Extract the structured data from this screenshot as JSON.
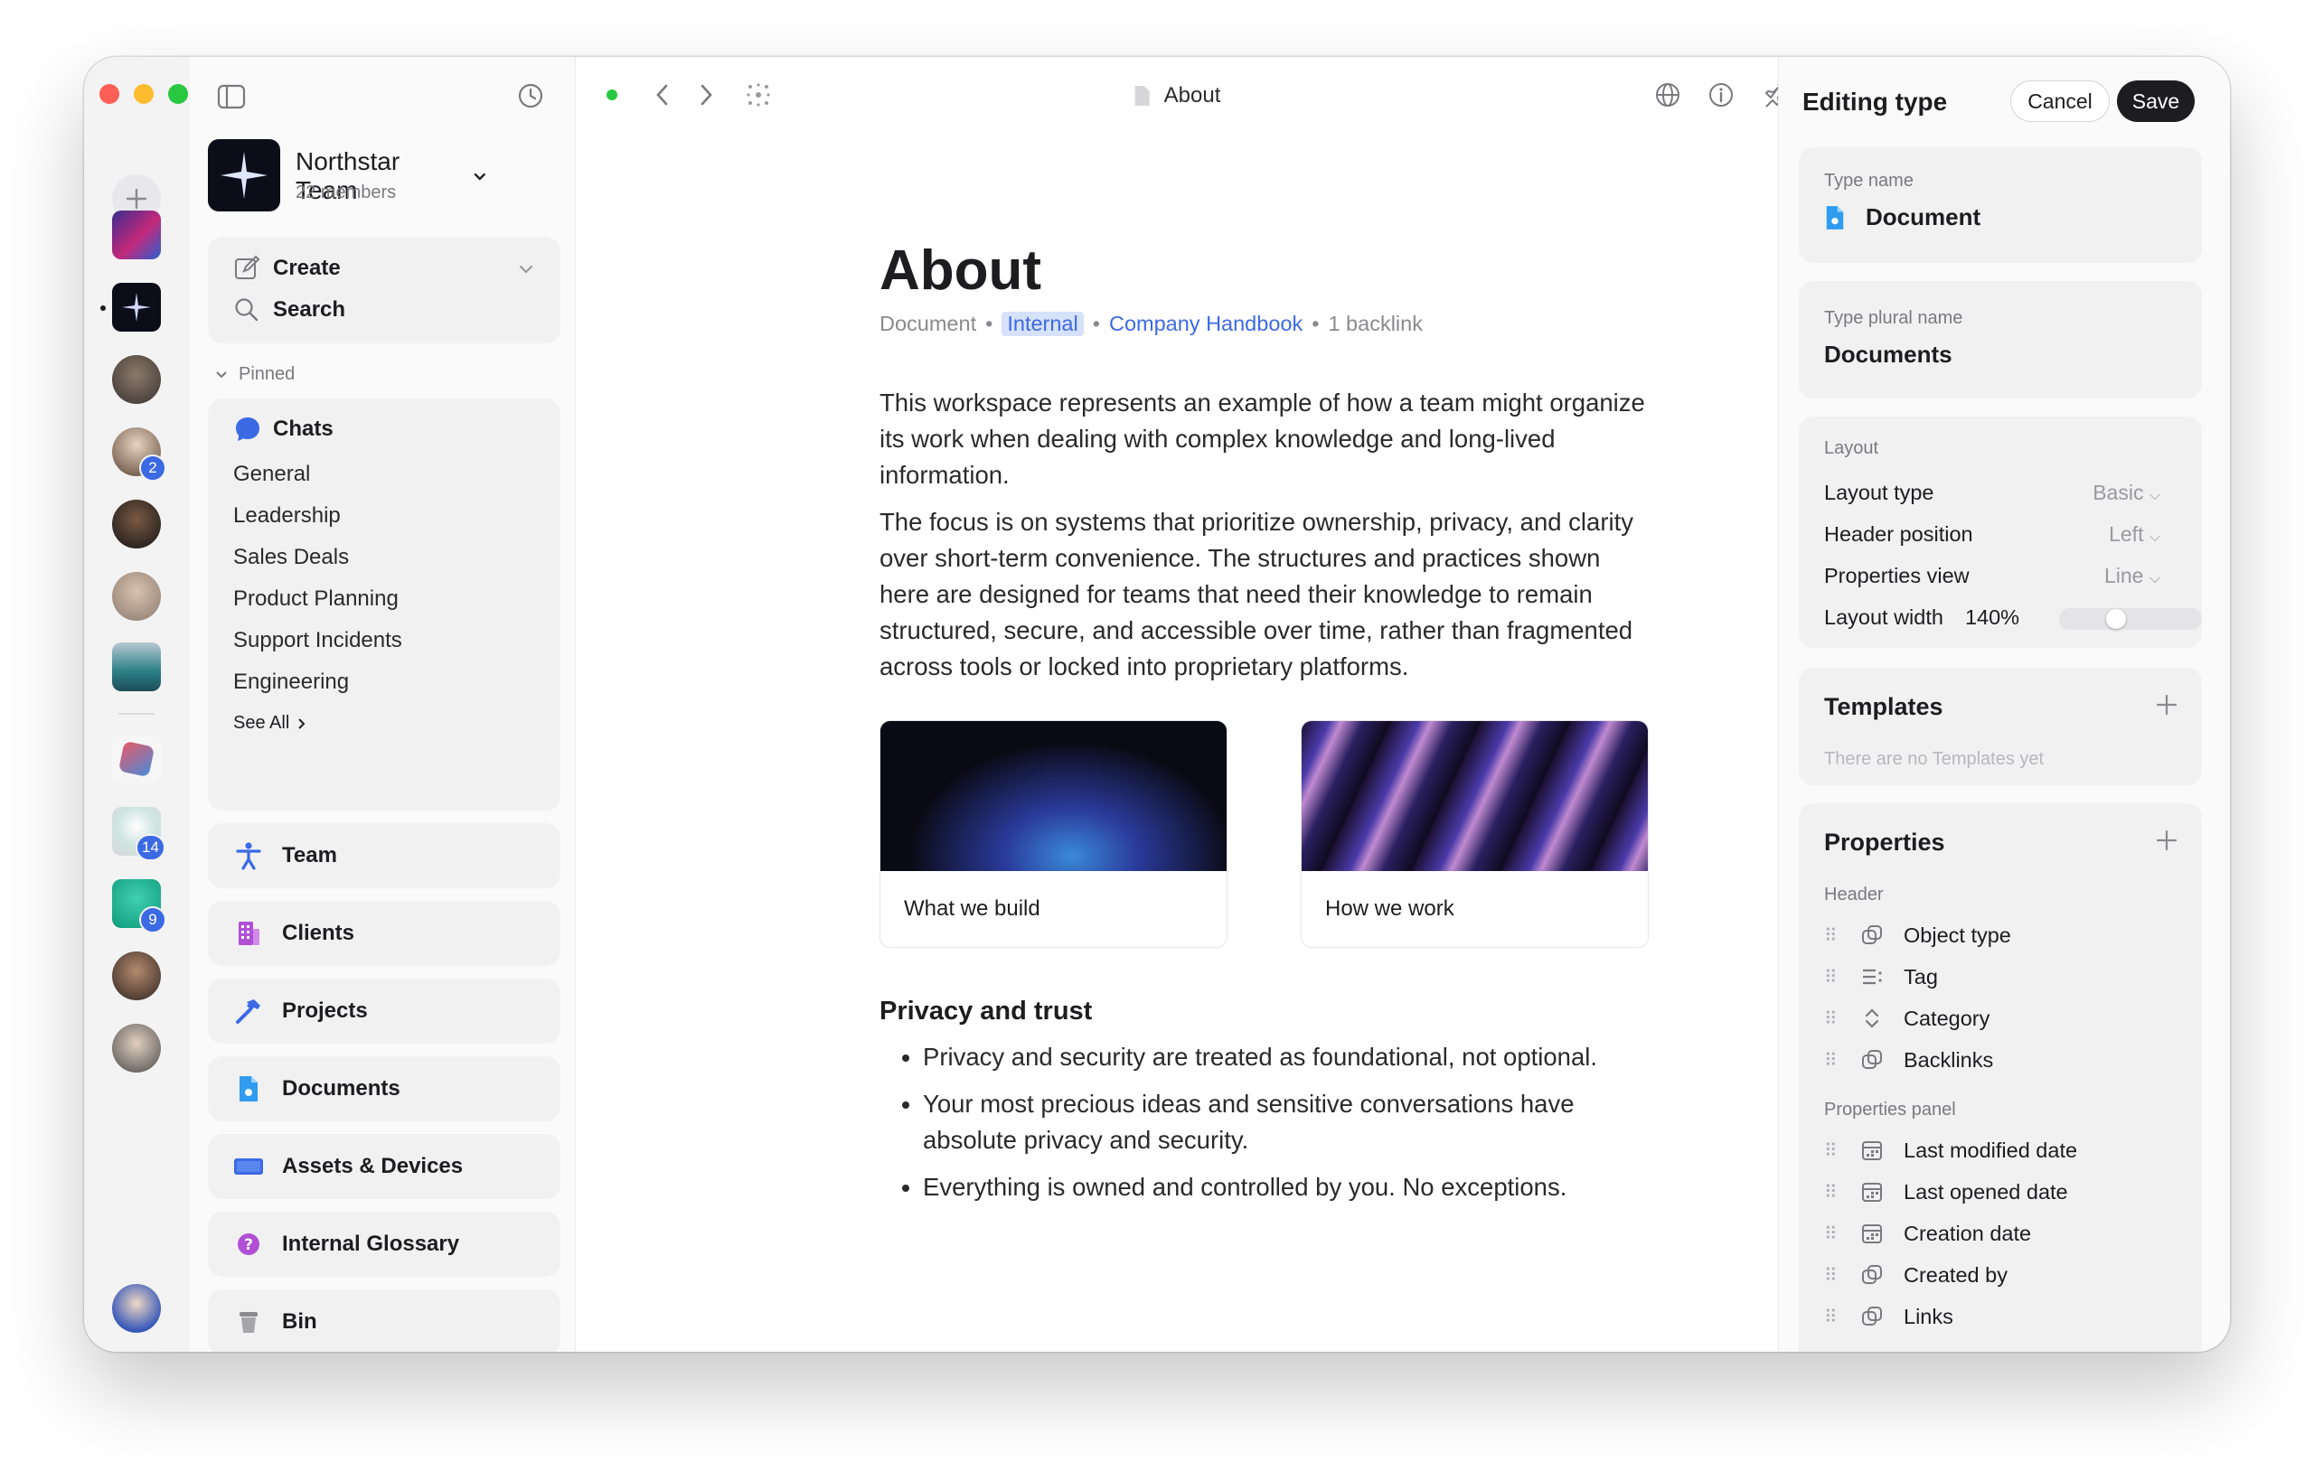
{
  "workspace": {
    "name": "Northstar Team",
    "members": "22 members",
    "badges": {
      "space_a": "2",
      "space_b": "14",
      "space_c": "9"
    }
  },
  "sidebar": {
    "create_label": "Create",
    "search_label": "Search",
    "pinned_label": "Pinned",
    "chats": {
      "title": "Chats",
      "items": [
        "General",
        "Leadership",
        "Sales Deals",
        "Product Planning",
        "Support Incidents",
        "Engineering"
      ],
      "see_all": "See All"
    },
    "nav": [
      {
        "label": "Team",
        "icon": "person-icon"
      },
      {
        "label": "Clients",
        "icon": "building-icon"
      },
      {
        "label": "Projects",
        "icon": "hammer-icon"
      },
      {
        "label": "Documents",
        "icon": "document-icon"
      },
      {
        "label": "Assets & Devices",
        "icon": "device-icon"
      },
      {
        "label": "Internal Glossary",
        "icon": "question-icon"
      },
      {
        "label": "Bin",
        "icon": "bin-icon"
      }
    ]
  },
  "topbar": {
    "title": "About"
  },
  "document": {
    "title": "About",
    "meta": {
      "type": "Document",
      "tag": "Internal",
      "link": "Company Handbook",
      "backlinks": "1 backlink"
    },
    "paragraphs": [
      "This workspace represents an example of how a team might organize its work when dealing with complex knowledge and long-lived information.",
      "The focus is on systems that prioritize ownership, privacy, and clarity over short-term convenience. The structures and practices shown here are designed for teams that need their knowledge to remain structured, secure, and accessible over time, rather than fragmented across tools or locked into proprietary platforms."
    ],
    "cards": [
      "What we build",
      "How we work"
    ],
    "section_heading": "Privacy and trust",
    "bullets": [
      "Privacy and security are treated as foundational, not optional.",
      "Your most precious ideas and sensitive conversations have absolute privacy and security.",
      "Everything is owned and controlled by you. No exceptions."
    ]
  },
  "panel": {
    "title": "Editing type",
    "cancel": "Cancel",
    "save": "Save",
    "type_name_label": "Type name",
    "type_name": "Document",
    "plural_label": "Type plural name",
    "plural": "Documents",
    "layout": {
      "label": "Layout",
      "rows": [
        {
          "name": "Layout type",
          "value": "Basic"
        },
        {
          "name": "Header position",
          "value": "Left"
        },
        {
          "name": "Properties view",
          "value": "Line"
        }
      ],
      "width_label": "Layout width",
      "width_value": "140%",
      "width_fraction": 0.4
    },
    "templates": {
      "title": "Templates",
      "empty": "There are no Templates yet"
    },
    "properties": {
      "title": "Properties",
      "header_label": "Header",
      "header_items": [
        {
          "label": "Object type",
          "icon": "link-icon"
        },
        {
          "label": "Tag",
          "icon": "list-icon"
        },
        {
          "label": "Category",
          "icon": "select-icon"
        },
        {
          "label": "Backlinks",
          "icon": "link-icon"
        }
      ],
      "panel_label": "Properties panel",
      "panel_items": [
        {
          "label": "Last modified date",
          "icon": "calendar-icon"
        },
        {
          "label": "Last opened date",
          "icon": "calendar-icon"
        },
        {
          "label": "Creation date",
          "icon": "calendar-icon"
        },
        {
          "label": "Created by",
          "icon": "link-icon"
        },
        {
          "label": "Links",
          "icon": "link-icon"
        }
      ]
    }
  },
  "colors": {
    "accent": "#3c6ae4",
    "save_bg": "#1d1d1f",
    "tag_bg": "#d6e1fb"
  }
}
